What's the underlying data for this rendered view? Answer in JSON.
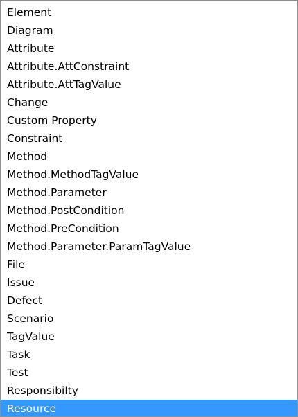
{
  "list": {
    "selected_index": 22,
    "items": [
      {
        "label": "Element"
      },
      {
        "label": "Diagram"
      },
      {
        "label": "Attribute"
      },
      {
        "label": "Attribute.AttConstraint"
      },
      {
        "label": "Attribute.AttTagValue"
      },
      {
        "label": "Change"
      },
      {
        "label": "Custom Property"
      },
      {
        "label": "Constraint"
      },
      {
        "label": "Method"
      },
      {
        "label": "Method.MethodTagValue"
      },
      {
        "label": "Method.Parameter"
      },
      {
        "label": "Method.PostCondition"
      },
      {
        "label": "Method.PreCondition"
      },
      {
        "label": "Method.Parameter.ParamTagValue"
      },
      {
        "label": "File"
      },
      {
        "label": "Issue"
      },
      {
        "label": "Defect"
      },
      {
        "label": "Scenario"
      },
      {
        "label": "TagValue"
      },
      {
        "label": "Task"
      },
      {
        "label": "Test"
      },
      {
        "label": "Responsibilty"
      },
      {
        "label": "Resource"
      }
    ]
  },
  "colors": {
    "selection_background": "#3399ff",
    "selection_text": "#ffffff",
    "border": "#8e8f8f"
  }
}
